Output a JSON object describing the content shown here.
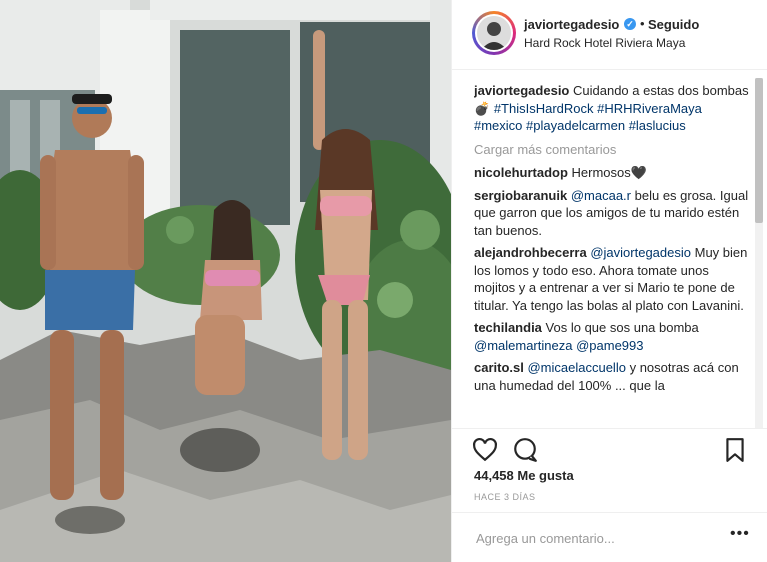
{
  "post": {
    "username": "javiortegadesio",
    "verified_icon": "verified-badge-icon",
    "separator": "•",
    "follow_status": "Seguido",
    "location": "Hard Rock Hotel Riviera Maya"
  },
  "caption": {
    "user": "javiortegadesio",
    "text": "Cuidando a estas dos bombas",
    "emoji": "💣",
    "tags": [
      "#ThisIsHardRock",
      "#HRHRiveraMaya",
      "#mexico",
      "#playadelcarmen",
      "#laslucius"
    ]
  },
  "load_more": "Cargar más comentarios",
  "comments": [
    {
      "user": "nicolehurtadop",
      "text": "Hermosos",
      "suffix": "🖤"
    },
    {
      "user": "sergiobaranuik",
      "mention": "@macaa.r",
      "text": "belu es grosa. Igual que garron que los amigos de tu marido estén tan buenos."
    },
    {
      "user": "alejandrohbecerra",
      "mention": "@javiortegadesio",
      "text": "Muy bien los lomos y todo eso. Ahora tomate unos mojitos y a entrenar a ver si Mario te pone de titular. Ya tengo las bolas al plato con Lavanini."
    },
    {
      "user": "techilandia",
      "text": "Vos lo que sos una bomba",
      "mentions": [
        "@malemartineza",
        "@pame993"
      ]
    },
    {
      "user": "carito.sl",
      "mention": "@micaelaccuello",
      "text": "y nosotras acá con una humedad del 100% ... que la"
    }
  ],
  "actions": {
    "like_icon": "heart-icon",
    "comment_icon": "comment-icon",
    "save_icon": "bookmark-icon"
  },
  "likes_text": "44,458 Me gusta",
  "timestamp": "HACE 3 DÍAS",
  "add_comment": {
    "placeholder": "Agrega un comentario...",
    "more_icon": "ellipsis-icon",
    "more_label": "•••"
  },
  "colors": {
    "link": "#003569",
    "muted": "#999999",
    "verified": "#3897f0",
    "border": "#efefef"
  }
}
